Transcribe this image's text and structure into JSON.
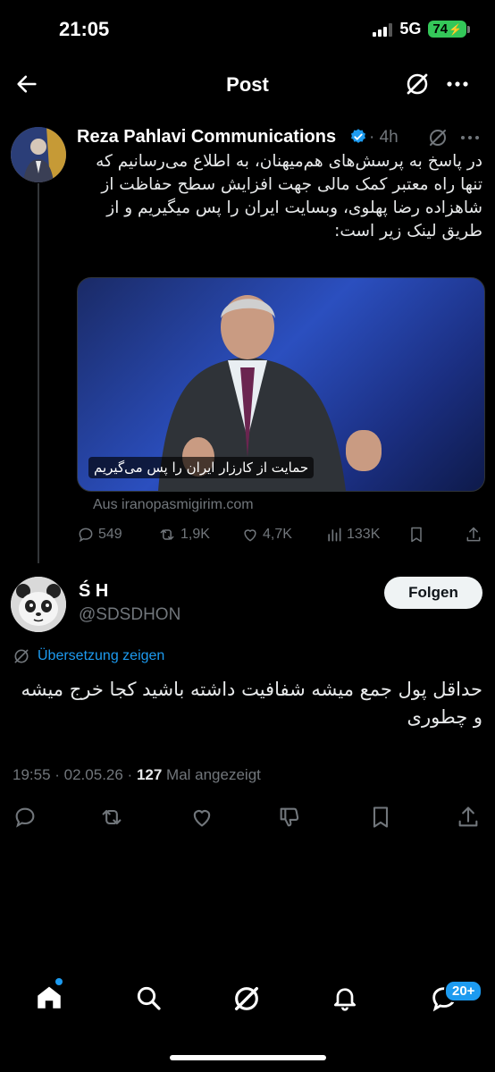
{
  "status_bar": {
    "time": "21:05",
    "network": "5G",
    "battery": "74"
  },
  "header": {
    "title": "Post",
    "back_icon": "arrow-left-icon",
    "grok_icon": "grok-icon",
    "more_icon": "more-icon"
  },
  "post": {
    "author": "Reza Pahlavi Communications",
    "time": "4h",
    "text": "در پاسخ به پرسش‌های هم‌میهنان، به اطلاع می‌رسانیم که تنها راه معتبر کمک مالی جهت افزایش سطح حفاظت از شاهزاده رضا پهلوی، وبسایت ایران را پس میگیریم و از طریق لینک زیر است:",
    "card_caption": "حمایت از کارزار ایران را پس می‌گیریم",
    "card_source": "Aus iranopasmigirim.com",
    "metrics": {
      "replies": "549",
      "reposts": "1,9K",
      "likes": "4,7K",
      "views": "133K"
    }
  },
  "reply": {
    "name": "Ś H",
    "handle": "@SDSDHON",
    "follow_label": "Folgen",
    "translate_label": "Übersetzung zeigen",
    "text": "حداقل پول جمع میشه شفافیت داشته باشید کجا خرج میشه و چطوری",
    "timestamp": "19:55 · 02.05.26 · ",
    "views_count": "127",
    "views_label": " Mal angezeigt"
  },
  "bottom_nav": {
    "messages_badge": "20+"
  },
  "colors": {
    "accent": "#1d9bf0",
    "muted": "#71767b",
    "background": "#000000"
  }
}
